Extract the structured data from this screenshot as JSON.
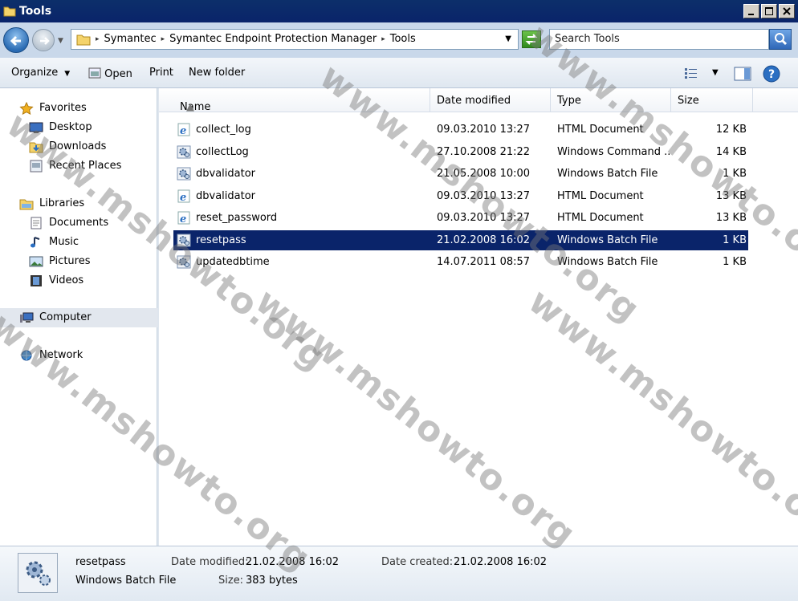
{
  "window": {
    "title": "Tools"
  },
  "address": {
    "crumbs": [
      "Symantec",
      "Symantec Endpoint Protection Manager",
      "Tools"
    ],
    "search_placeholder": "Search Tools"
  },
  "toolbar": {
    "organize": "Organize",
    "open": "Open",
    "print": "Print",
    "new_folder": "New folder"
  },
  "nav": {
    "favorites": "Favorites",
    "desktop": "Desktop",
    "downloads": "Downloads",
    "recent": "Recent Places",
    "libraries": "Libraries",
    "documents": "Documents",
    "music": "Music",
    "pictures": "Pictures",
    "videos": "Videos",
    "computer": "Computer",
    "network": "Network"
  },
  "columns": {
    "name": "Name",
    "date": "Date modified",
    "type": "Type",
    "size": "Size"
  },
  "files": [
    {
      "name": "collect_log",
      "date": "09.03.2010 13:27",
      "type": "HTML Document",
      "size": "12 KB",
      "icon": "html-icon"
    },
    {
      "name": "collectLog",
      "date": "27.10.2008 21:22",
      "type": "Windows Command ...",
      "size": "14 KB",
      "icon": "gear-file-icon"
    },
    {
      "name": "dbvalidator",
      "date": "21.05.2008 10:00",
      "type": "Windows Batch File",
      "size": "1 KB",
      "icon": "gear-file-icon"
    },
    {
      "name": "dbvalidator",
      "date": "09.03.2010 13:27",
      "type": "HTML Document",
      "size": "13 KB",
      "icon": "html-icon"
    },
    {
      "name": "reset_password",
      "date": "09.03.2010 13:27",
      "type": "HTML Document",
      "size": "13 KB",
      "icon": "html-icon"
    },
    {
      "name": "resetpass",
      "date": "21.02.2008 16:02",
      "type": "Windows Batch File",
      "size": "1 KB",
      "icon": "gear-file-icon"
    },
    {
      "name": "updatedbtime",
      "date": "14.07.2011 08:57",
      "type": "Windows Batch File",
      "size": "1 KB",
      "icon": "gear-file-icon"
    }
  ],
  "details": {
    "name": "resetpass",
    "type": "Windows Batch File",
    "modified_label": "Date modified:",
    "modified": "21.02.2008 16:02",
    "created_label": "Date created:",
    "created": "21.02.2008 16:02",
    "size_label": "Size:",
    "size": "383 bytes"
  },
  "watermark": "www.mshowto.org"
}
